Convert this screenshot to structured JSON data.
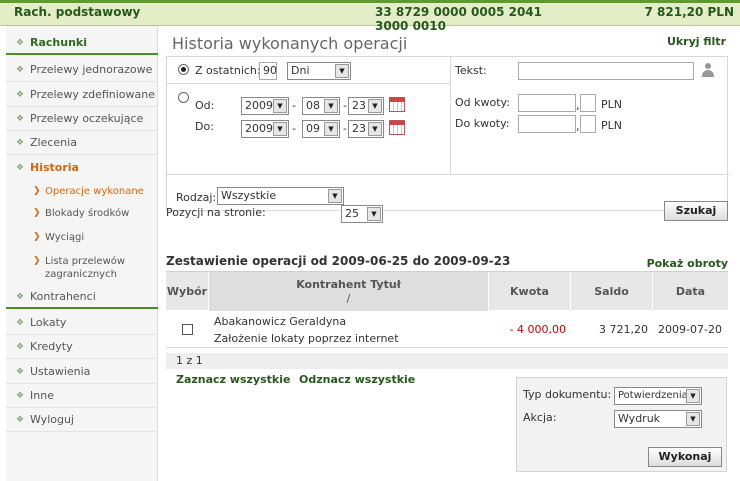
{
  "header": {
    "account_type": "Rach. podstawowy",
    "account_number": "33 8729 0000 0005 2041 3000 0010",
    "balance": "7 821,20 PLN"
  },
  "sidebar": {
    "items": [
      {
        "label": "Rachunki"
      },
      {
        "label": "Przelewy jednorazowe"
      },
      {
        "label": "Przelewy zdefiniowane"
      },
      {
        "label": "Przelewy oczekujące"
      },
      {
        "label": "Zlecenia"
      },
      {
        "label": "Historia"
      },
      {
        "label": "Kontrahenci"
      },
      {
        "label": "Lokaty"
      },
      {
        "label": "Kredyty"
      },
      {
        "label": "Ustawienia"
      },
      {
        "label": "Inne"
      },
      {
        "label": "Wyloguj"
      }
    ],
    "subitems": [
      {
        "label": "Operacje wykonane"
      },
      {
        "label": "Blokady środków"
      },
      {
        "label": "Wyciągi"
      },
      {
        "label": "Lista przelewów zagranicznych"
      }
    ]
  },
  "page": {
    "title": "Historia wykonanych operacji",
    "hide_filter": "Ukryj filtr"
  },
  "filter": {
    "last_label": "Z ostatnich:",
    "last_value": "90",
    "unit_value": "Dni",
    "from_label": "Od:",
    "to_label": "Do:",
    "from_year": "2009",
    "from_month": "08",
    "from_day": "23",
    "to_year": "2009",
    "to_month": "09",
    "to_day": "23",
    "text_label": "Tekst:",
    "text_value": "",
    "amount_from_label": "Od kwoty:",
    "amount_to_label": "Do kwoty:",
    "currency": "PLN",
    "type_label": "Rodzaj:",
    "type_value": "Wszystkie"
  },
  "paging": {
    "per_page_label": "Pozycji na stronie:",
    "per_page_value": "25",
    "search_button": "Szukaj"
  },
  "summary": {
    "title": "Zestawienie operacji od 2009-06-25 do 2009-09-23",
    "show_turnover": "Pokaż obroty"
  },
  "table": {
    "headers": {
      "select": "Wybór",
      "counterparty": "Kontrahent Tytuł",
      "slash": "/",
      "amount": "Kwota",
      "balance": "Saldo",
      "date": "Data"
    },
    "rows": [
      {
        "counterparty": "Abakanowicz Geraldyna",
        "title": "Założenie lokaty poprzez internet",
        "amount": "- 4 000,00",
        "balance": "3 721,20",
        "date": "2009-07-20"
      }
    ],
    "pager": "1 z 1"
  },
  "actions": {
    "select_all": "Zaznacz wszystkie",
    "deselect_all": "Odznacz wszystkie",
    "doc_type_label": "Typ dokumentu:",
    "doc_type_value": "Potwierdzenia",
    "action_label": "Akcja:",
    "action_value": "Wydruk",
    "execute_button": "Wykonaj"
  },
  "colors": {
    "brand_green": "#25581a",
    "accent_orange": "#d6670d",
    "amount_negative": "#cc0000"
  }
}
